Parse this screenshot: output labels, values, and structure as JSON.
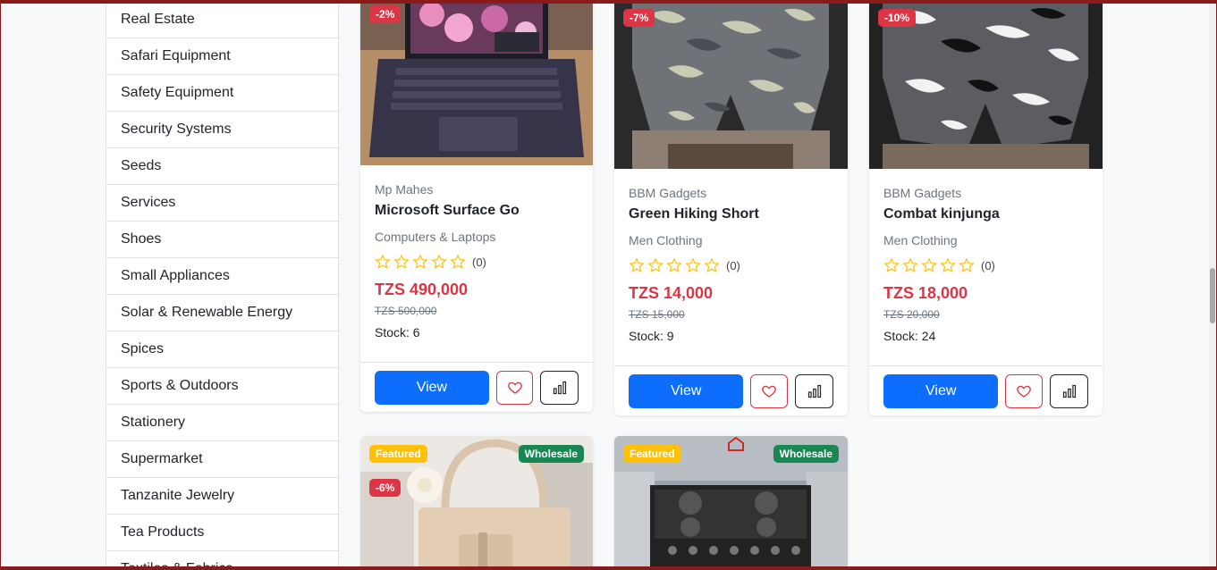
{
  "categories": [
    "Real Estate",
    "Safari Equipment",
    "Safety Equipment",
    "Security Systems",
    "Seeds",
    "Services",
    "Shoes",
    "Small Appliances",
    "Solar & Renewable Energy",
    "Spices",
    "Sports & Outdoors",
    "Stationery",
    "Supermarket",
    "Tanzanite Jewelry",
    "Tea Products",
    "Textiles & Fabrics"
  ],
  "products": [
    {
      "discount": "-2%",
      "seller": "Mp Mahes",
      "name": "Microsoft Surface Go",
      "category": "Computers & Laptops",
      "rating_count": "(0)",
      "price": "TZS 490,000",
      "old_price": "TZS 500,000",
      "stock": "Stock: 6",
      "view_label": "View"
    },
    {
      "discount": "-7%",
      "seller": "BBM Gadgets",
      "name": "Green Hiking Short",
      "category": "Men Clothing",
      "rating_count": "(0)",
      "price": "TZS 14,000",
      "old_price": "TZS 15,000",
      "stock": "Stock: 9",
      "view_label": "View"
    },
    {
      "discount": "-10%",
      "seller": "BBM Gadgets",
      "name": "Combat kinjunga",
      "category": "Men Clothing",
      "rating_count": "(0)",
      "price": "TZS 18,000",
      "old_price": "TZS 20,000",
      "stock": "Stock: 24",
      "view_label": "View"
    },
    {
      "featured": "Featured",
      "wholesale": "Wholesale",
      "discount": "-6%"
    },
    {
      "featured": "Featured",
      "wholesale": "Wholesale"
    }
  ],
  "colors": {
    "primary": "#0d6efd",
    "danger": "#dc3545",
    "warning": "#ffc107",
    "success": "#198754"
  },
  "icons": {
    "star": "star-outline-icon",
    "heart": "heart-icon",
    "compare": "bar-chart-icon"
  }
}
